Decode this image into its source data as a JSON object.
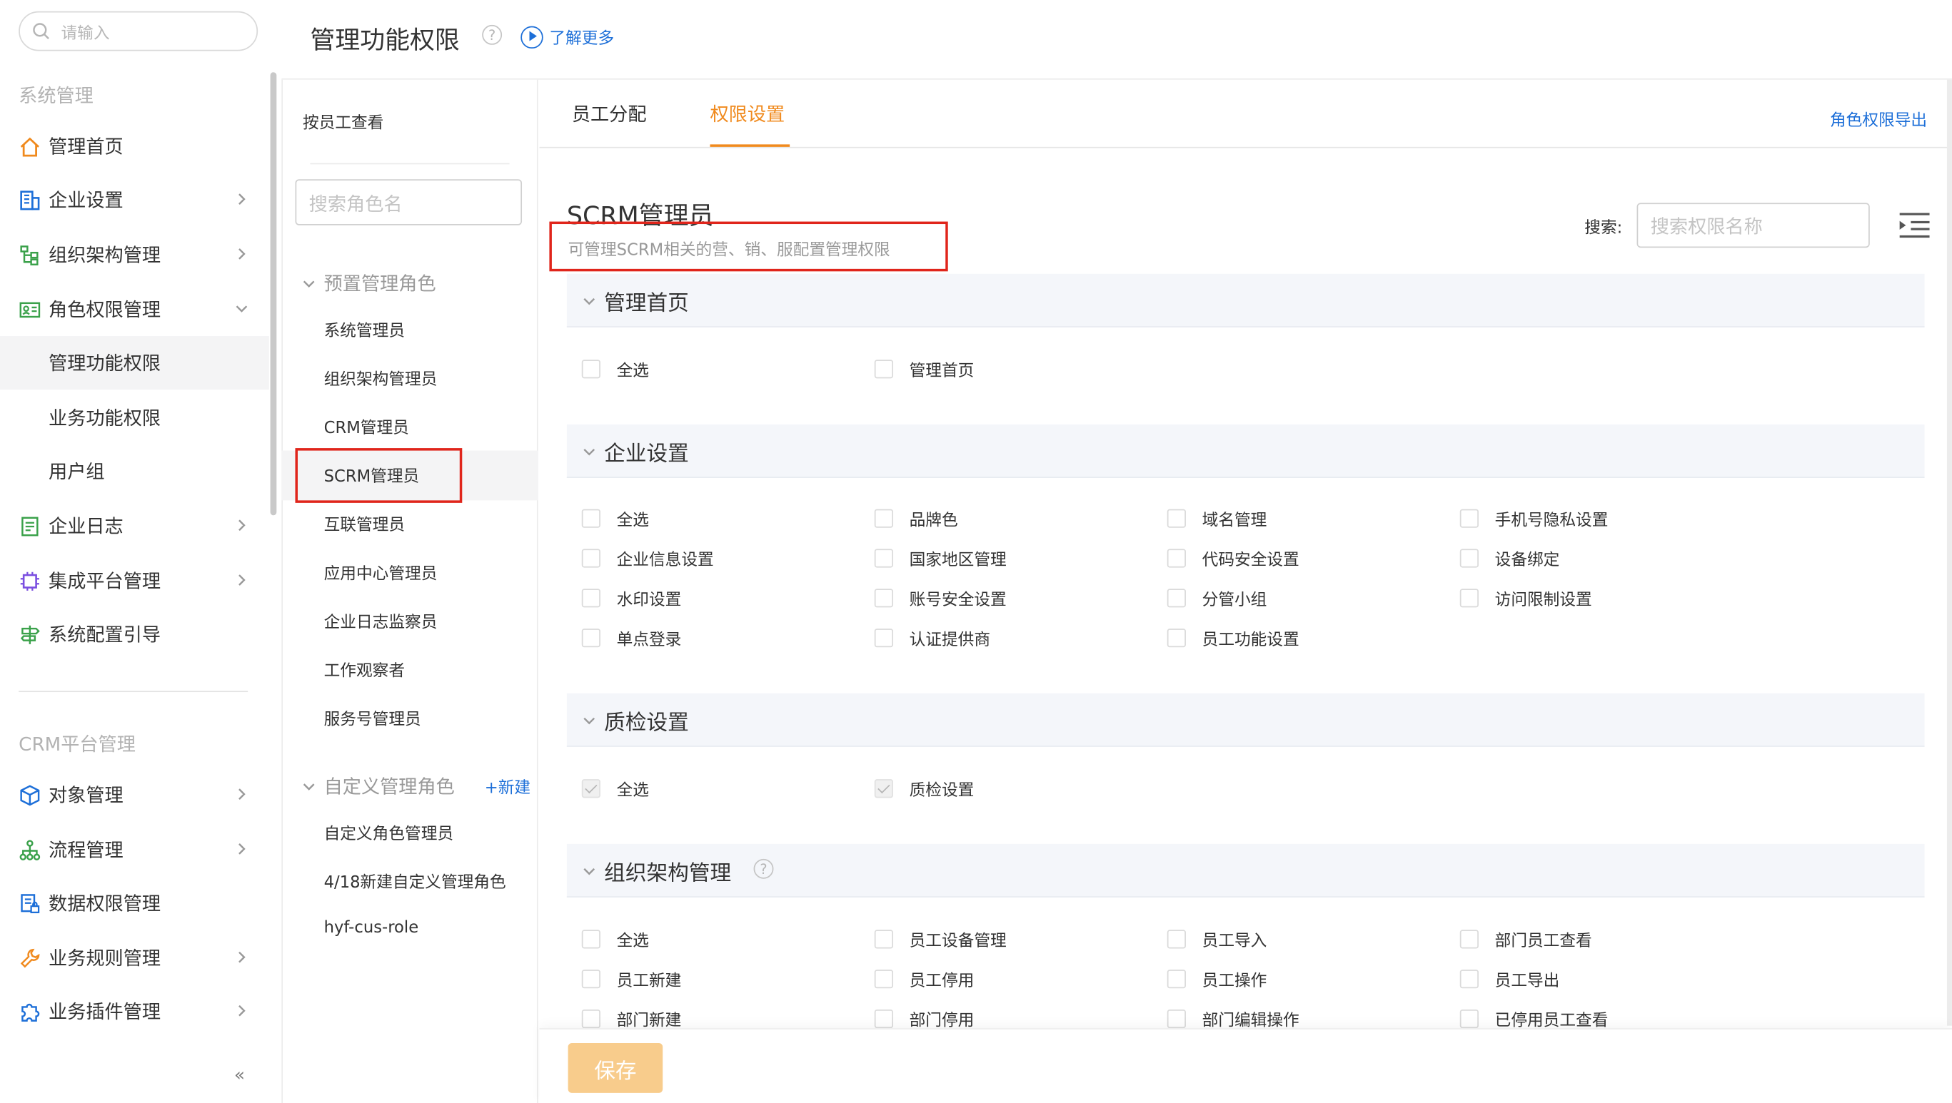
{
  "sidebar": {
    "search_placeholder": "请输入",
    "section1": "系统管理",
    "section2": "CRM平台管理",
    "items": [
      {
        "label": "管理首页"
      },
      {
        "label": "企业设置"
      },
      {
        "label": "组织架构管理"
      },
      {
        "label": "角色权限管理"
      },
      {
        "label": "管理功能权限"
      },
      {
        "label": "业务功能权限"
      },
      {
        "label": "用户组"
      },
      {
        "label": "企业日志"
      },
      {
        "label": "集成平台管理"
      },
      {
        "label": "系统配置引导"
      }
    ],
    "crm_items": [
      {
        "label": "对象管理"
      },
      {
        "label": "流程管理"
      },
      {
        "label": "数据权限管理"
      },
      {
        "label": "业务规则管理"
      },
      {
        "label": "业务插件管理"
      }
    ],
    "collapse": "«"
  },
  "header": {
    "title": "管理功能权限",
    "help": "?",
    "learn_more": "了解更多"
  },
  "role_panel": {
    "by_employee": "按员工查看",
    "search_placeholder": "搜索角色名",
    "preset_group": "预置管理角色",
    "preset_roles": [
      "系统管理员",
      "组织架构管理员",
      "CRM管理员",
      "SCRM管理员",
      "互联管理员",
      "应用中心管理员",
      "企业日志监察员",
      "工作观察者",
      "服务号管理员"
    ],
    "custom_group": "自定义管理角色",
    "new_link": "+新建",
    "custom_roles": [
      "自定义角色管理员",
      "4/18新建自定义管理角色",
      "hyf-cus-role"
    ]
  },
  "tabs": {
    "assign": "员工分配",
    "perm": "权限设置",
    "export": "角色权限导出"
  },
  "role": {
    "name": "SCRM管理员",
    "desc": "可管理SCRM相关的营、销、服配置管理权限"
  },
  "perm_search": {
    "label": "搜索:",
    "placeholder": "搜索权限名称"
  },
  "sections": {
    "s1": {
      "title": "管理首页",
      "items": [
        "全选",
        "管理首页"
      ]
    },
    "s2": {
      "title": "企业设置",
      "items": [
        "全选",
        "品牌色",
        "域名管理",
        "手机号隐私设置",
        "企业信息设置",
        "国家地区管理",
        "代码安全设置",
        "设备绑定",
        "水印设置",
        "账号安全设置",
        "分管小组",
        "访问限制设置",
        "单点登录",
        "认证提供商",
        "员工功能设置"
      ]
    },
    "s3": {
      "title": "质检设置",
      "items": [
        "全选",
        "质检设置"
      ]
    },
    "s4": {
      "title": "组织架构管理",
      "help": "?",
      "items": [
        "全选",
        "员工设备管理",
        "员工导入",
        "部门员工查看",
        "员工新建",
        "员工停用",
        "员工操作",
        "员工导出",
        "部门新建",
        "部门停用",
        "部门编辑操作",
        "已停用员工查看"
      ]
    }
  },
  "save_label": "保存"
}
